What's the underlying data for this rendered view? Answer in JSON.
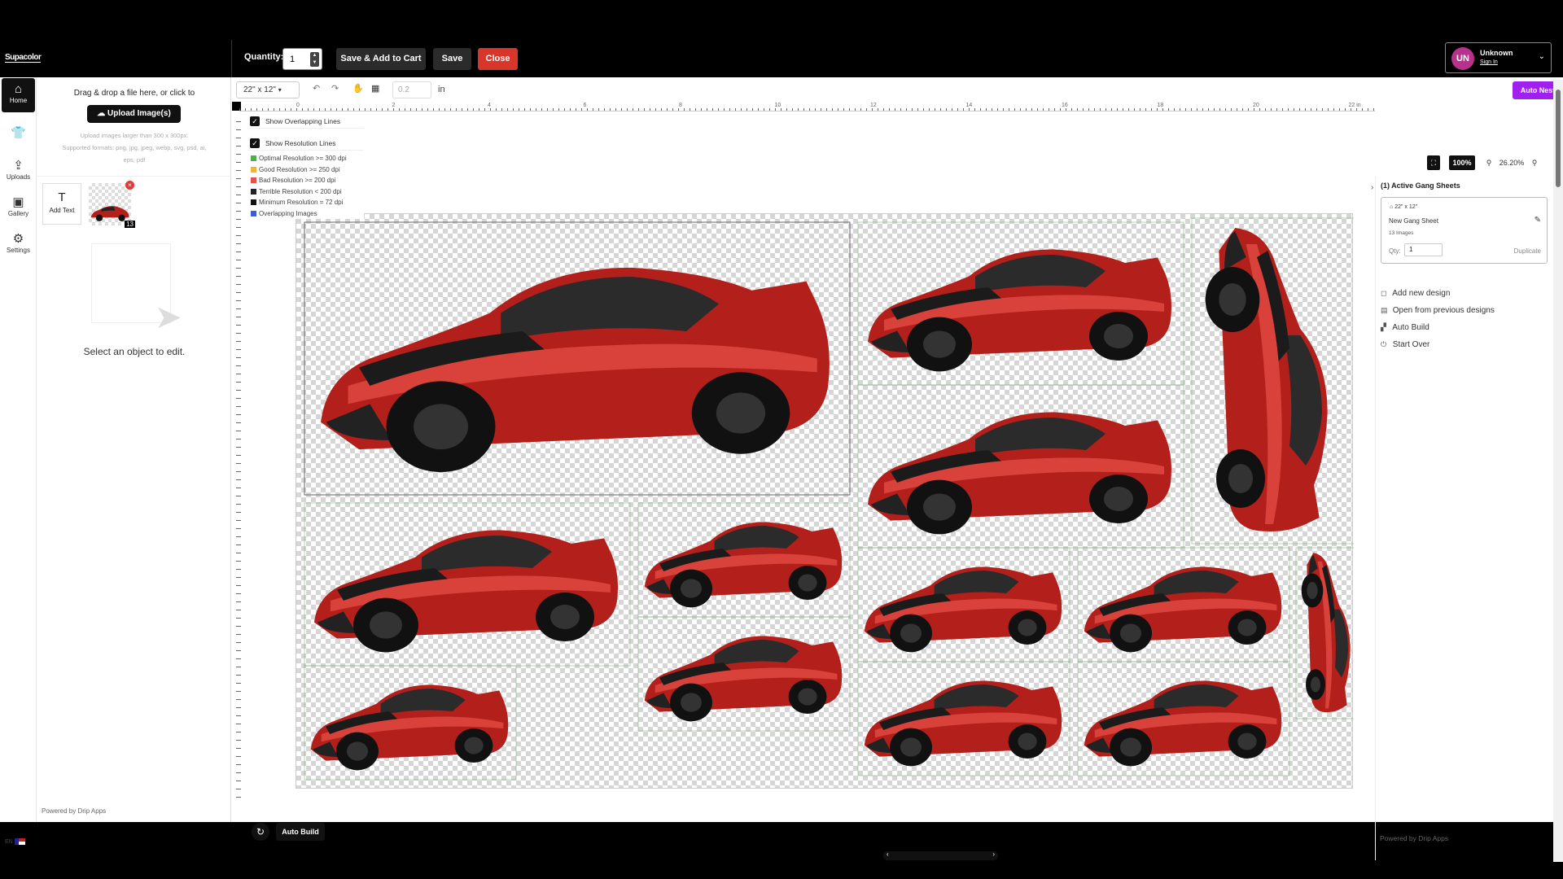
{
  "topbar": {
    "logo": "Supacolor",
    "quantity_label": "Quantity:",
    "quantity_value": "1",
    "save_add_cart": "Save & Add to Cart",
    "save": "Save",
    "close": "Close",
    "user_initials": "UN",
    "user_name": "Unknown",
    "sign_in": "Sign In"
  },
  "nav": {
    "items": [
      {
        "label": "Home",
        "icon": "home-icon"
      },
      {
        "label": "",
        "icon": "tshirt-icon"
      },
      {
        "label": "Uploads",
        "icon": "upload-icon"
      },
      {
        "label": "Gallery",
        "icon": "gallery-icon"
      },
      {
        "label": "Settings",
        "icon": "gear-icon"
      }
    ],
    "lang": "EN"
  },
  "panel": {
    "drop_text": "Drag & drop a file here, or click to",
    "upload_button": "Upload Image(s)",
    "upload_info_1": "Upload images larger than 300 x 300px.",
    "upload_info_2": "Supported formats: png, jpg, jpeg, webp, svg, psd, ai,",
    "upload_info_3": "eps, pdf",
    "add_text": "Add Text",
    "thumb_count": "13",
    "select_text": "Select an object to edit.",
    "powered": "Powered by Drip Apps"
  },
  "toolbar": {
    "size": "22\" x 12\"",
    "step_value": "0.2",
    "unit": "in",
    "auto_nest": "Auto Nest"
  },
  "legend": {
    "show_overlapping": "Show Overlapping Lines",
    "show_resolution": "Show Resolution Lines",
    "rows": [
      {
        "label": "Optimal Resolution >= 300 dpi",
        "color": "#4caf50"
      },
      {
        "label": "Good Resolution >= 250 dpi",
        "color": "#f2b632"
      },
      {
        "label": "Bad Resolution >= 200 dpi",
        "color": "#e0554a"
      },
      {
        "label": "Terrible Resolution < 200 dpi",
        "color": "#222222"
      },
      {
        "label": "Minimum Resolution = 72 dpi",
        "color": "#111111"
      },
      {
        "label": "Overlapping Images",
        "color": "#3b5bdb"
      }
    ]
  },
  "ruler": {
    "top": [
      "0",
      "2",
      "4",
      "6",
      "8",
      "10",
      "12",
      "14",
      "16",
      "18",
      "20",
      "22 in"
    ]
  },
  "canvas": {
    "autobuild": "Auto Build"
  },
  "right": {
    "zoom_fit": "100%",
    "zoom_value": "26.20%",
    "active_head": "(1)   Active Gang Sheets",
    "card_size": "22\" x 12\"",
    "card_name": "New Gang Sheet",
    "card_count": "13 Images",
    "qty_label": "Qty:",
    "qty_value": "1",
    "duplicate": "Duplicate",
    "actions": [
      "Add new design",
      "Open from previous designs",
      "Auto Build",
      "Start Over"
    ],
    "powered": "Powered by Drip Apps"
  }
}
